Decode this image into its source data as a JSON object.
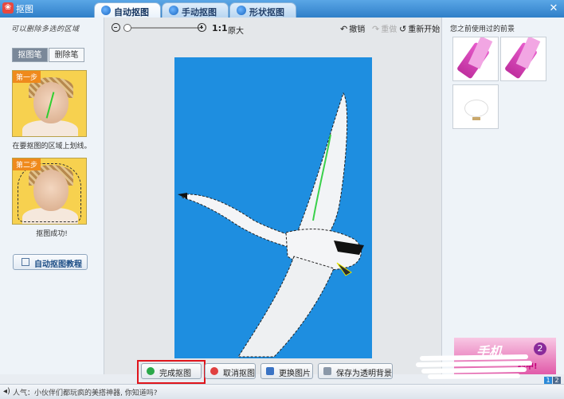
{
  "window": {
    "title": "抠图",
    "close_glyph": "✕"
  },
  "tabs": [
    {
      "label": "自动抠图",
      "active": true
    },
    {
      "label": "手动抠图",
      "active": false
    },
    {
      "label": "形状抠图",
      "active": false
    }
  ],
  "left_panel": {
    "hint": "可以删除多选的区域",
    "brush": {
      "keep_label": "抠图笔",
      "erase_label": "删除笔"
    },
    "step1": {
      "badge": "第一步",
      "caption": "在要抠图的区域上划线。"
    },
    "step2": {
      "badge": "第二步",
      "caption": "抠图成功!"
    },
    "tutorial_label": "自动抠图教程"
  },
  "toolbar": {
    "ratio": "1:1",
    "original": "原大",
    "undo": "撤销",
    "redo": "重做",
    "restart": "重新开始",
    "zoom_level": 0.0
  },
  "actions": {
    "finish": "完成抠图",
    "cancel": "取消抠图",
    "change": "更换图片",
    "save": "保存为透明背景"
  },
  "right_panel": {
    "title": "您之前使用过的前景",
    "ad_text": "手机",
    "ad_num": "2",
    "ad_sub": "约中!"
  },
  "pager": [
    "1",
    "2"
  ],
  "status": {
    "text": "人气：小伙伴们都玩疯的美搭神器, 你知道吗?"
  },
  "colors": {
    "photo_bg": "#1e8ee0",
    "highlight": "#e0151c",
    "finish_icon": "#2aa84a",
    "cancel_icon": "#e04040"
  }
}
